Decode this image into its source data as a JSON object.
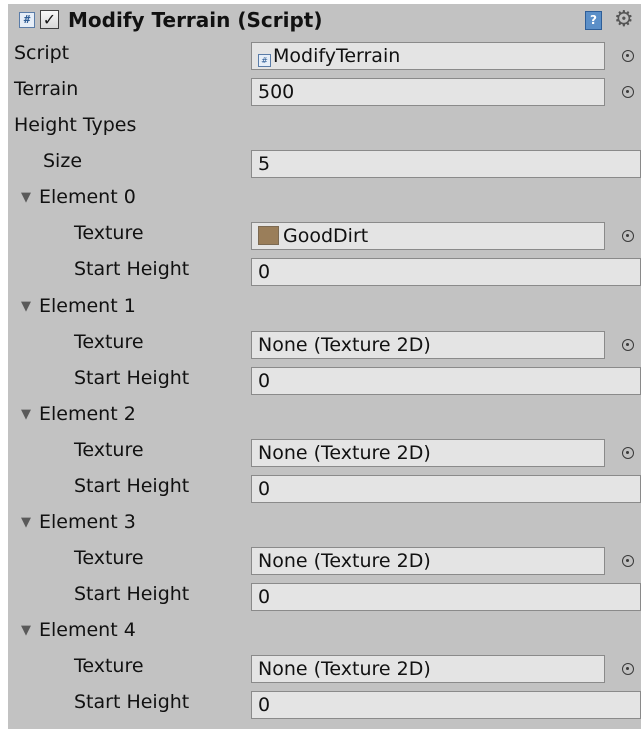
{
  "component": {
    "title": "Modify Terrain (Script)",
    "enabled": true,
    "icon": "csharp-script-icon",
    "help_icon": "book-icon",
    "settings_icon": "gear-icon"
  },
  "fields": {
    "script": {
      "label": "Script",
      "value": "ModifyTerrain",
      "icon": "csharp-script-icon"
    },
    "terrain": {
      "label": "Terrain",
      "value": "500"
    },
    "height_types": {
      "label": "Height Types"
    },
    "size": {
      "label": "Size",
      "value": "5"
    }
  },
  "labels": {
    "texture": "Texture",
    "start_height": "Start Height"
  },
  "elements": [
    {
      "label": "Element 0",
      "texture": "GoodDirt",
      "texture_color": "#9a7e5a",
      "start_height": "0"
    },
    {
      "label": "Element 1",
      "texture": "None (Texture 2D)",
      "start_height": "0"
    },
    {
      "label": "Element 2",
      "texture": "None (Texture 2D)",
      "start_height": "0"
    },
    {
      "label": "Element 3",
      "texture": "None (Texture 2D)",
      "start_height": "0"
    },
    {
      "label": "Element 4",
      "texture": "None (Texture 2D)",
      "start_height": "0"
    }
  ],
  "colors": {
    "panel_background": "#c2c2c2",
    "field_background": "#e4e4e4"
  }
}
